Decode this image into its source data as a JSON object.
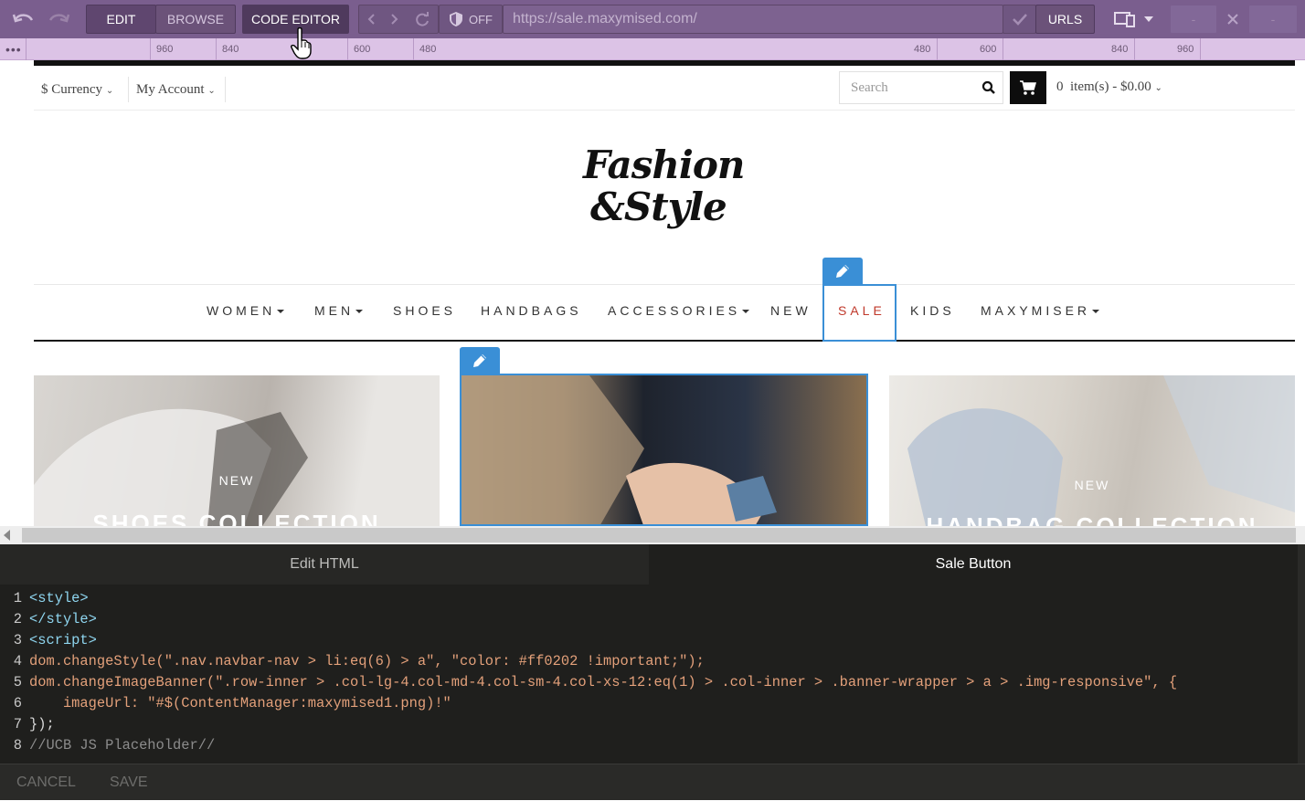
{
  "toolbar": {
    "edit": "EDIT",
    "browse": "BROWSE",
    "code_editor": "CODE EDITOR",
    "shield_state": "OFF",
    "url": "https://sale.maxymised.com/",
    "urls": "URLS"
  },
  "ruler": {
    "ticks": [
      "960",
      "840",
      "600",
      "480",
      "480",
      "600",
      "840",
      "960"
    ]
  },
  "site": {
    "currency": "$ Currency",
    "account": "My Account",
    "search_placeholder": "Search",
    "cart_count": "0",
    "cart_text": "item(s) - $0.00",
    "logo_line1": "Fashion",
    "logo_line2": "&Style",
    "nav": [
      "WOMEN",
      "MEN",
      "SHOES",
      "HANDBAGS",
      "ACCESSORIES",
      "NEW",
      "SALE",
      "KIDS",
      "MAXYMISER"
    ],
    "banners": [
      {
        "label": "NEW",
        "title": "SHOES COLLECTION"
      },
      {
        "label": "",
        "title": ""
      },
      {
        "label": "NEW",
        "title": "HANDBAG COLLECTION"
      }
    ],
    "colors": {
      "sale": "#c0392b",
      "selection": "#3a8fd6"
    }
  },
  "panel": {
    "tabs": [
      "Edit HTML",
      "Sale Button"
    ],
    "code_lines": [
      {
        "n": "1",
        "text": "<style>",
        "kind": "tag"
      },
      {
        "n": "2",
        "text": "</style>",
        "kind": "tag"
      },
      {
        "n": "3",
        "text": "<script>",
        "kind": "tag"
      },
      {
        "n": "4",
        "text": "dom.changeStyle(\".nav.navbar-nav > li:eq(6) > a\", \"color: #ff0202 !important;\");",
        "kind": "code"
      },
      {
        "n": "5",
        "text": "dom.changeImageBanner(\".row-inner > .col-lg-4.col-md-4.col-sm-4.col-xs-12:eq(1) > .col-inner > .banner-wrapper > a > .img-responsive\", {",
        "kind": "code"
      },
      {
        "n": "6",
        "text": "    imageUrl: \"#$(ContentManager:maxymised1.png)!\"",
        "kind": "code"
      },
      {
        "n": "7",
        "text": "});",
        "kind": "code"
      },
      {
        "n": "8",
        "text": "//UCB JS Placeholder//",
        "kind": "comment"
      }
    ],
    "cancel": "CANCEL",
    "save": "SAVE"
  }
}
